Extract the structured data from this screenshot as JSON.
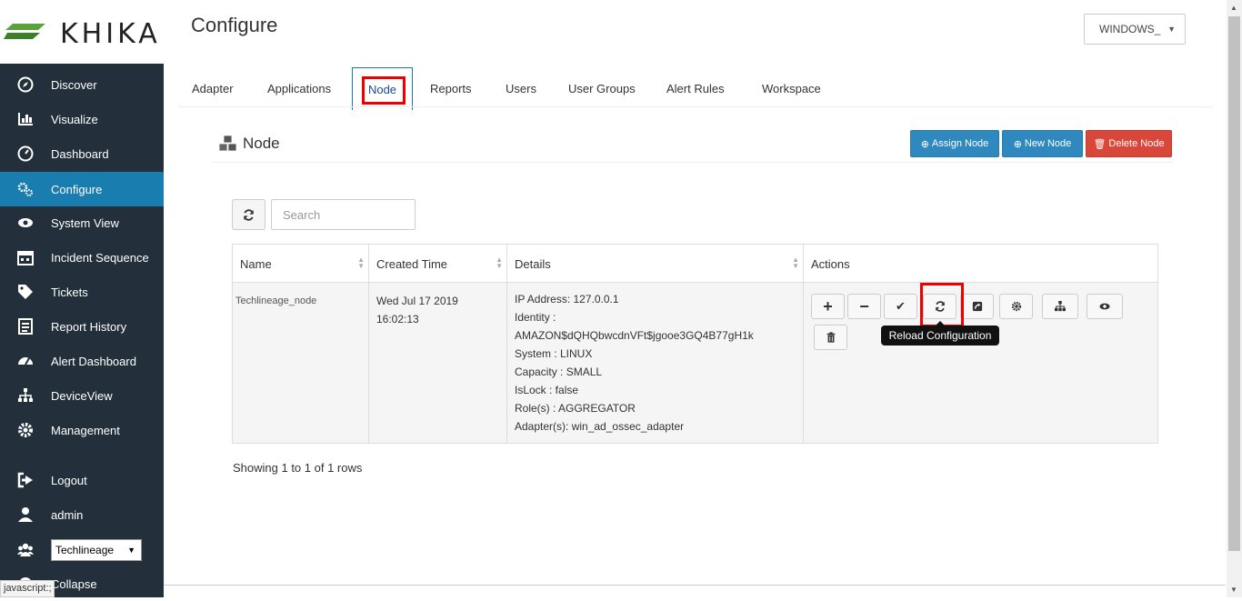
{
  "app": {
    "brand": "KHIKA"
  },
  "header": {
    "title": "Configure",
    "workspace": "WINDOWS_"
  },
  "sidebar": {
    "items": [
      {
        "label": "Discover",
        "icon": "compass-icon"
      },
      {
        "label": "Visualize",
        "icon": "bar-chart-icon"
      },
      {
        "label": "Dashboard",
        "icon": "dashboard-icon"
      },
      {
        "label": "Configure",
        "icon": "cogs-icon",
        "active": true
      },
      {
        "label": "System View",
        "icon": "eye-icon"
      },
      {
        "label": "Incident Sequence",
        "icon": "calendar-icon"
      },
      {
        "label": "Tickets",
        "icon": "tag-icon"
      },
      {
        "label": "Report History",
        "icon": "list-icon"
      },
      {
        "label": "Alert Dashboard",
        "icon": "tachometer-icon"
      },
      {
        "label": "DeviceView",
        "icon": "sitemap-icon"
      },
      {
        "label": "Management",
        "icon": "gear-icon"
      },
      {
        "label": "Logout",
        "icon": "sign-out-icon"
      },
      {
        "label": "admin",
        "icon": "user-icon"
      }
    ],
    "org_select": "Techlineage",
    "collapse": "Collapse",
    "status_text": "javascript:;"
  },
  "tabs": [
    "Adapter",
    "Applications",
    "Node",
    "Reports",
    "Users",
    "User Groups",
    "Alert Rules",
    "Workspace"
  ],
  "active_tab": "Node",
  "section": {
    "title": "Node",
    "assign_btn": "Assign Node",
    "new_btn": "New Node",
    "delete_btn": "Delete Node"
  },
  "toolbar": {
    "search_placeholder": "Search"
  },
  "table": {
    "columns": [
      "Name",
      "Created Time",
      "Details",
      "Actions"
    ],
    "rows": [
      {
        "name": "Techlineage_node",
        "created": [
          "Wed Jul 17 2019",
          "16:02:13"
        ],
        "details": [
          "IP Address: 127.0.0.1",
          "Identity :",
          "AMAZON$dQHQbwcdnVFt$jgooe3GQ4B77gH1k",
          "System : LINUX",
          "Capacity : SMALL",
          "IsLock : false",
          "Role(s) : AGGREGATOR",
          "Adapter(s): win_ad_ossec_adapter"
        ]
      }
    ],
    "tooltip": "Reload Configuration",
    "footer": "Showing 1 to 1 of 1 rows"
  },
  "colors": {
    "sidebar": "#23303b",
    "active": "#1a7db0",
    "primary": "#2f89bf",
    "danger": "#d9473a",
    "highlight": "#e00000"
  }
}
